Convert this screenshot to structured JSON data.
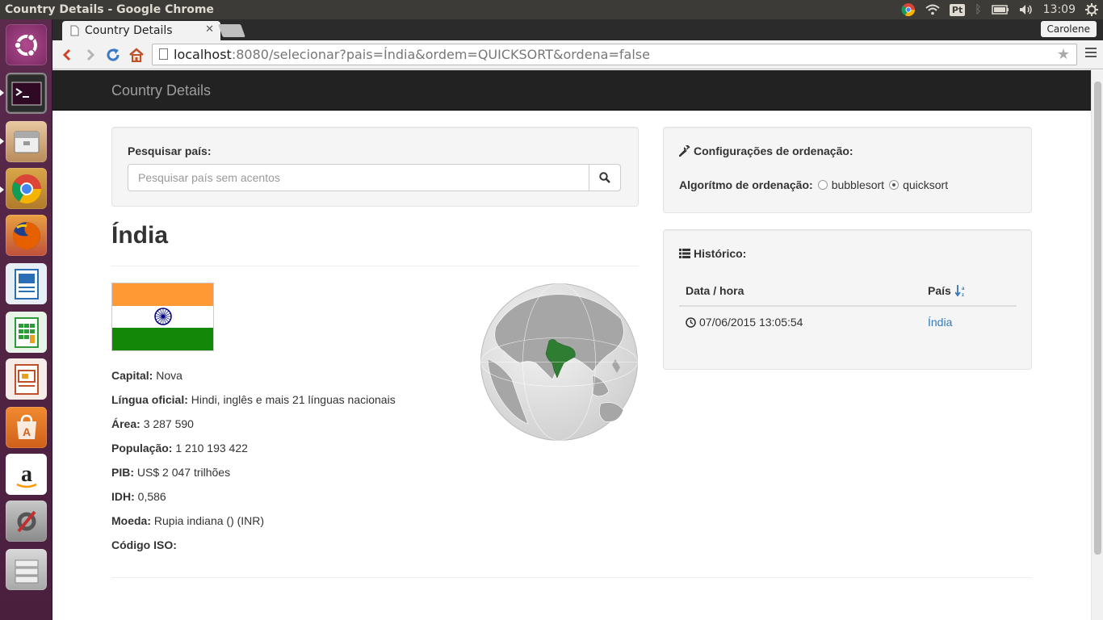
{
  "os_panel": {
    "window_title": "Country Details - Google Chrome",
    "clock": "13:09",
    "keyboard_layout": "Pt"
  },
  "browser": {
    "tab_title": "Country Details",
    "profile_name": "Carolene",
    "url_host": "localhost",
    "url_rest": ":8080/selecionar?pais=Índia&ordem=QUICKSORT&ordena=false"
  },
  "page": {
    "brand": "Country Details",
    "search": {
      "label": "Pesquisar país:",
      "placeholder": "Pesquisar país sem acentos",
      "value": ""
    },
    "country": {
      "name": "Índia",
      "flag_colors": [
        "#ff9933",
        "#ffffff",
        "#138808"
      ],
      "fields": [
        {
          "label": "Capital:",
          "value": "Nova"
        },
        {
          "label": "Língua oficial:",
          "value": "Hindi, inglês e mais 21 línguas nacionais"
        },
        {
          "label": "Área:",
          "value": "3 287 590"
        },
        {
          "label": "População:",
          "value": "1 210 193 422"
        },
        {
          "label": "PIB:",
          "value": "US$ 2 047 trilhões"
        },
        {
          "label": "IDH:",
          "value": "0,586"
        },
        {
          "label": "Moeda:",
          "value": "Rupia indiana () (INR)"
        },
        {
          "label": "Código ISO:",
          "value": ""
        }
      ]
    },
    "sorting": {
      "title": "Configurações de ordenação:",
      "algorithm_label": "Algorítmo de ordenação:",
      "options": [
        {
          "label": "bubblesort",
          "checked": false
        },
        {
          "label": "quicksort",
          "checked": true
        }
      ]
    },
    "history": {
      "title": "Histórico:",
      "columns": [
        "Data / hora",
        "País"
      ],
      "rows": [
        {
          "datetime": "07/06/2015 13:05:54",
          "country": "Índia"
        }
      ]
    }
  },
  "icons": {
    "launcher": [
      "ubuntu-dash-icon",
      "terminal-icon",
      "files-icon",
      "chrome-icon",
      "firefox-icon",
      "writer-icon",
      "calc-icon",
      "impress-icon",
      "software-center-icon",
      "amazon-icon",
      "settings-icon",
      "workspaces-icon"
    ]
  }
}
